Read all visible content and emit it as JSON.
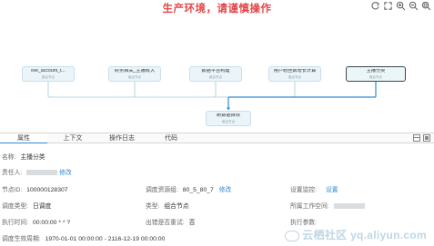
{
  "header": {
    "warning": "生产环境，请谨慎操作"
  },
  "toolbar": {
    "icons": [
      "refresh-icon",
      "expand-icon",
      "zoom-in-icon",
      "zoom-out-icon",
      "fit-screen-icon"
    ]
  },
  "graph": {
    "nodes": [
      {
        "name": "live_account_t...",
        "type": "组合节点"
      },
      {
        "name": "财务相关_主播收入",
        "type": "组合节点"
      },
      {
        "name": "数据平台构建",
        "type": "组合节点"
      },
      {
        "name": "用户粉丝数增长计算",
        "type": "组合节点"
      },
      {
        "name": "主播分类",
        "type": "组合节点"
      }
    ],
    "target": {
      "name": "新数据目标",
      "type": "组合节点"
    }
  },
  "tabs": [
    "属性",
    "上下文",
    "操作日志",
    "代码"
  ],
  "props": {
    "name_label": "名称:",
    "name_value": "主播分类",
    "owner_label": "责任人:",
    "owner_edit": "修改",
    "node_id_label": "节点ID:",
    "node_id_value": "100000128307",
    "resource_group_label": "调度资源组:",
    "resource_group_value": "80_5_80_7",
    "resource_group_edit": "修改",
    "monitor_label": "设置监控:",
    "monitor_link": "设置",
    "schedule_type_label": "调度类型:",
    "schedule_type_value": "日调度",
    "type_label": "类型:",
    "type_value": "组合节点",
    "workspace_label": "所属工作空间:",
    "exec_time_label": "执行时间:",
    "exec_time_value": "00:00:00 * * ?",
    "retry_label": "出错是否重试:",
    "retry_value": "否",
    "exec_params_label": "执行参数:",
    "effective_label": "调度生效周期:",
    "effective_value": "1970-01-01 00:00:00 - 2116-12-19 00:00:00"
  },
  "watermark": "云栖社区 yq.aliyun.com",
  "colors": {
    "warning": "#e2474a",
    "accent": "#2e8ad6",
    "node_bg": "#eaf4f9"
  }
}
